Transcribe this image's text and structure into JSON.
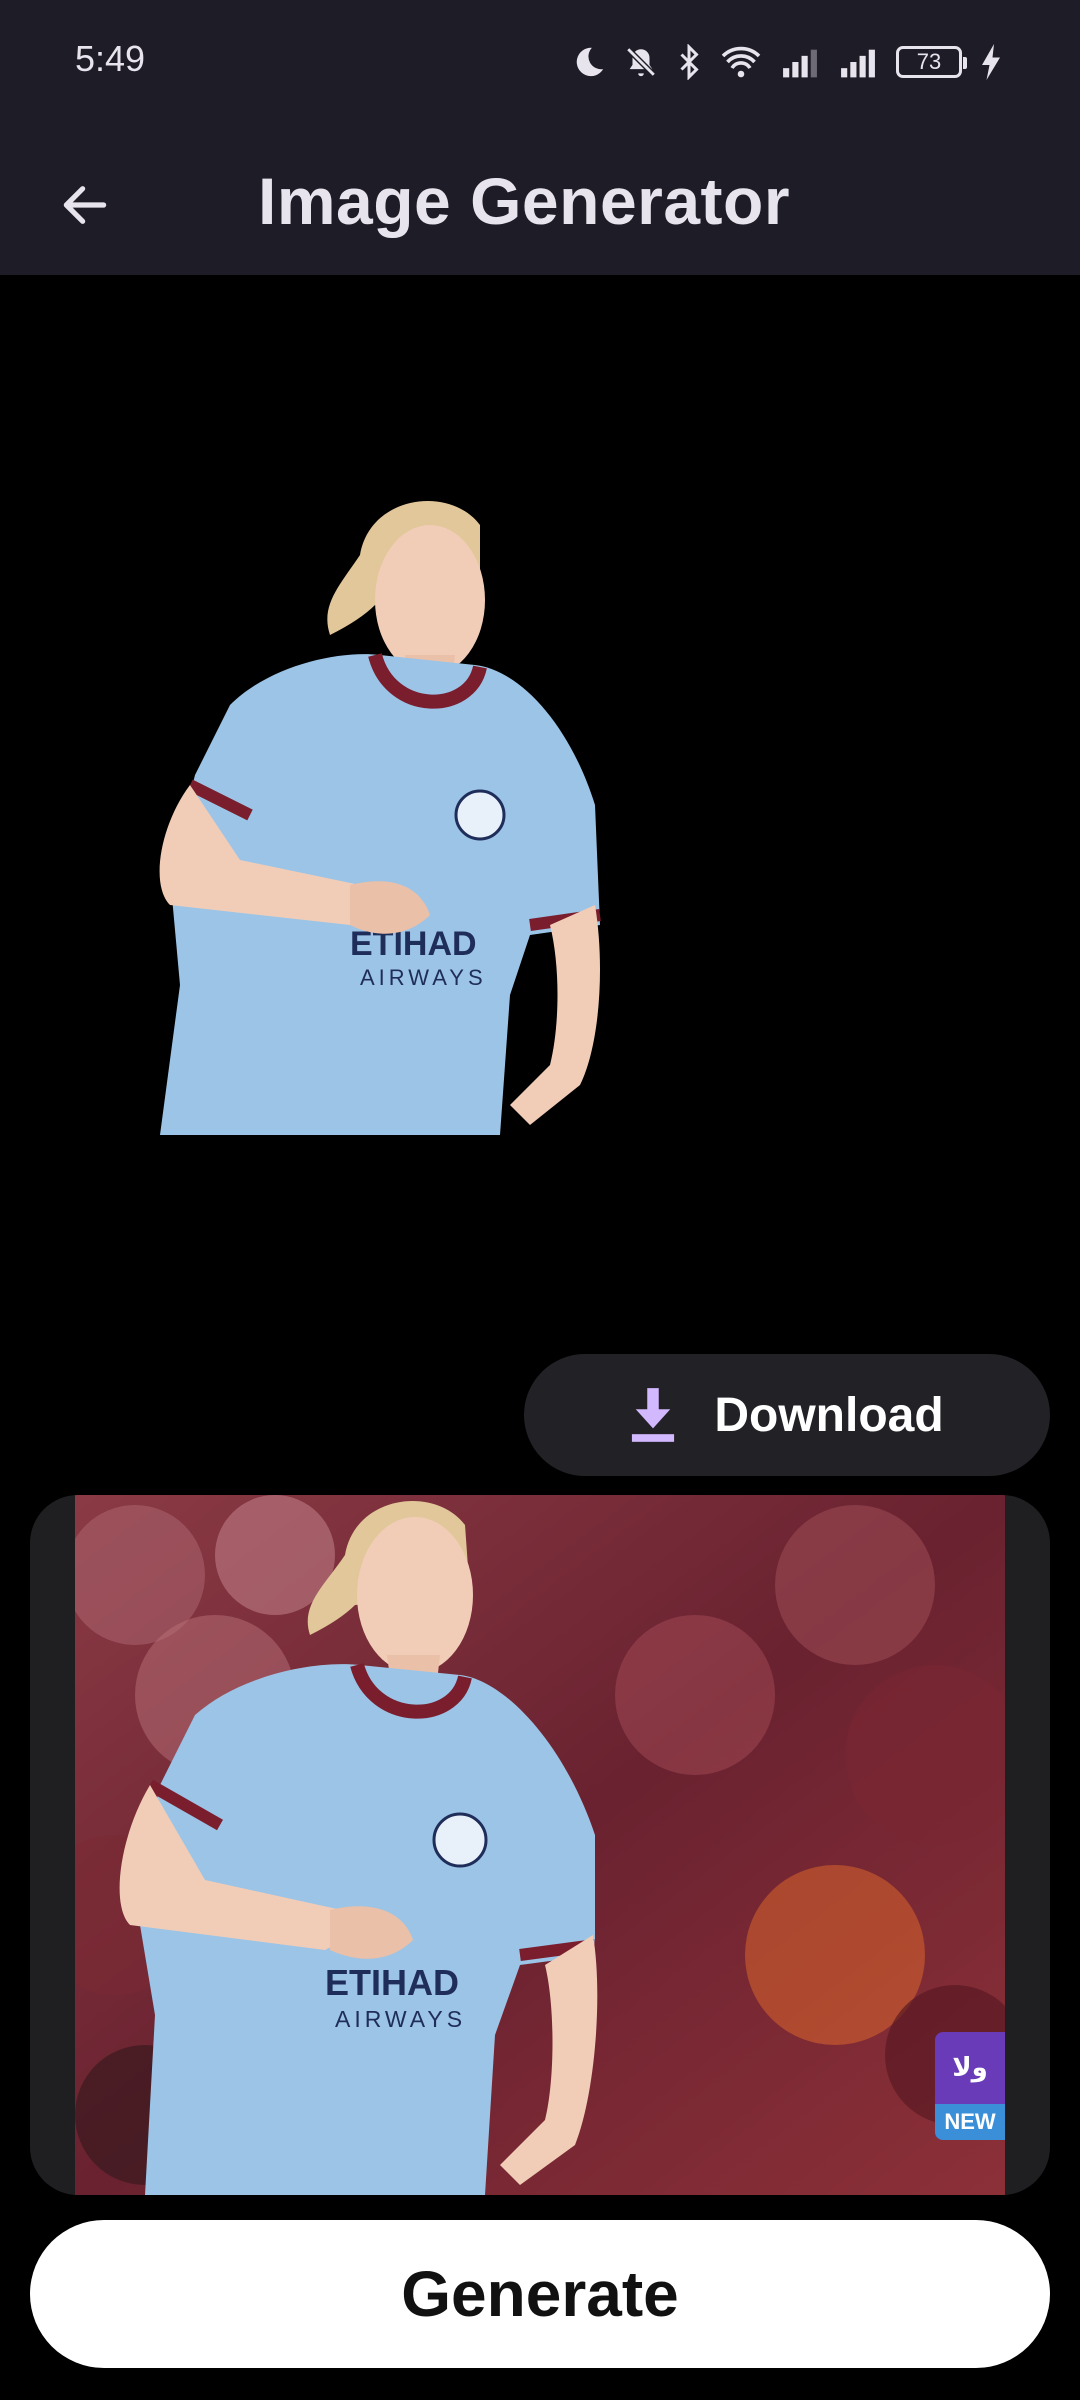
{
  "status_bar": {
    "time": "5:49",
    "battery_level": "73",
    "icons": [
      "moon-icon",
      "bell-off-icon",
      "bluetooth-icon",
      "wifi-icon",
      "signal-icon",
      "signal-icon",
      "battery-icon",
      "charging-icon"
    ]
  },
  "app_bar": {
    "title": "Image Generator",
    "back_icon": "arrow-left-icon"
  },
  "preview": {
    "description_icon": "generated-image"
  },
  "download": {
    "label": "Download",
    "icon": "download-icon",
    "icon_color": "#d2b8ff"
  },
  "source": {
    "watermark_logo": "ولا",
    "watermark_tag": "NEW"
  },
  "generate": {
    "label": "Generate"
  },
  "colors": {
    "app_bar_bg": "#1e1c26",
    "background": "#000000",
    "jersey": "#9cc4e6",
    "accent": "#d2b8ff"
  }
}
